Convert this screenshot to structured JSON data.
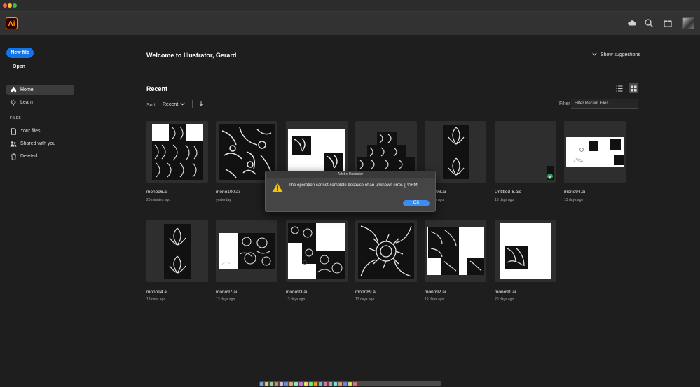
{
  "app": {
    "logo_text": "Ai"
  },
  "window": {
    "traffic_colors": [
      "#ff5f57",
      "#febc2e",
      "#28c840"
    ]
  },
  "topbar_icons": [
    "cloud-icon",
    "search-icon",
    "gift-icon",
    "apps-icon"
  ],
  "sidebar": {
    "new_file_label": "New file",
    "open_label": "Open",
    "nav": [
      {
        "label": "Home",
        "icon": "home-icon",
        "active": true
      },
      {
        "label": "Learn",
        "icon": "lightbulb-icon",
        "active": false
      }
    ],
    "files_section_label": "FILES",
    "files": [
      {
        "label": "Your files",
        "icon": "file-icon"
      },
      {
        "label": "Shared with you",
        "icon": "shared-icon"
      },
      {
        "label": "Deleted",
        "icon": "trash-icon"
      }
    ]
  },
  "main": {
    "welcome": "Welcome to Illustrator, Gerard",
    "show_suggestions": "Show suggestions",
    "recent_heading": "Recent",
    "sort_label": "Sort",
    "sort_value": "Recent",
    "filter_label": "Filter",
    "filter_placeholder": "Filter Recent Files",
    "files": [
      {
        "name": "mono96.ai",
        "date": "20 minutes ago"
      },
      {
        "name": "mono100.ai",
        "date": "yesterday"
      },
      {
        "name": "",
        "date": ""
      },
      {
        "name": "",
        "date": ""
      },
      {
        "name": "mono98.ai",
        "date": "13 days ago"
      },
      {
        "name": "Untitled-6.aic",
        "date": "13 days ago"
      },
      {
        "name": "mono94.ai",
        "date": "13 days ago"
      },
      {
        "name": "mono94.ai",
        "date": "13 days ago"
      },
      {
        "name": "mono97.ai",
        "date": "13 days ago"
      },
      {
        "name": "mono93.ai",
        "date": "13 days ago"
      },
      {
        "name": "mono89.ai",
        "date": "13 days ago"
      },
      {
        "name": "mono92.ai",
        "date": "19 days ago"
      },
      {
        "name": "mono91.ai",
        "date": "20 days ago"
      }
    ]
  },
  "dialog": {
    "title": "Adobe Illustrator",
    "message": "The operation cannot complete because of an unknown error.  [PARM]",
    "ok_label": "OK"
  },
  "colors": {
    "accent": "#1473e6",
    "background": "#1e1e1e"
  }
}
